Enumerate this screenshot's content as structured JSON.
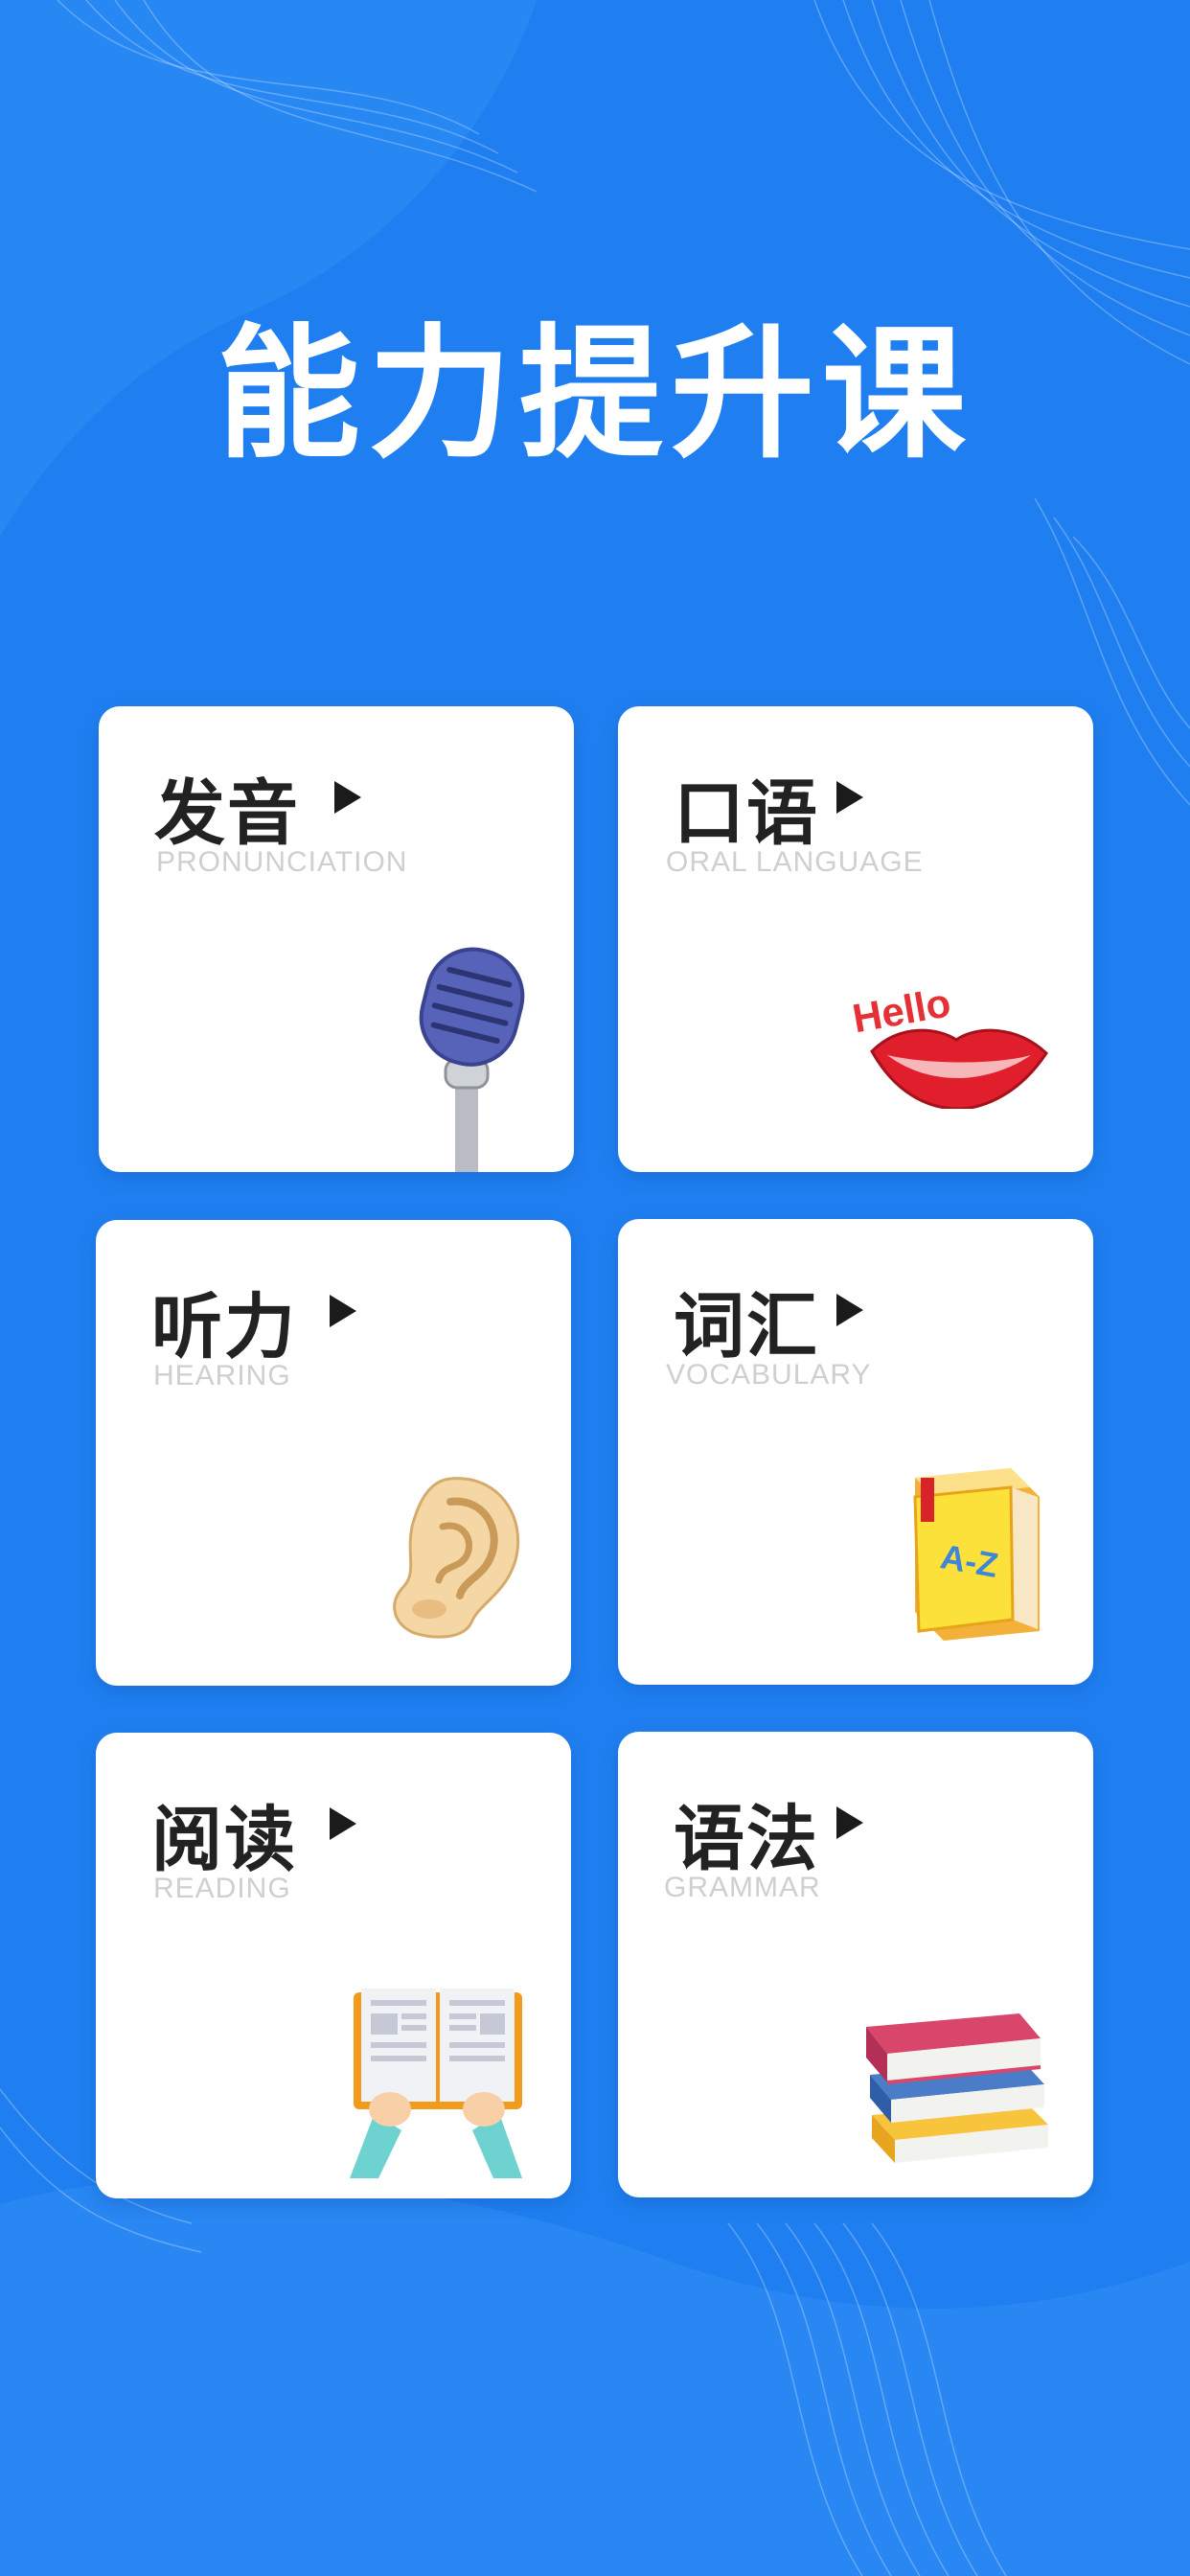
{
  "page": {
    "title": "能力提升课",
    "background_color": "#1f7ff0"
  },
  "cards": [
    {
      "title": "发音",
      "subtitle": "PRONUNCIATION",
      "illustration": "microphone-icon"
    },
    {
      "title": "口语",
      "subtitle": "ORAL LANGUAGE",
      "illustration": "hello-lips-icon",
      "illustration_text": "Hello"
    },
    {
      "title": "听力",
      "subtitle": "HEARING",
      "illustration": "ear-icon"
    },
    {
      "title": "词汇",
      "subtitle": "VOCABULARY",
      "illustration": "az-dictionary-icon",
      "illustration_text": "A-Z"
    },
    {
      "title": "阅读",
      "subtitle": "READING",
      "illustration": "open-book-hands-icon"
    },
    {
      "title": "语法",
      "subtitle": "GRAMMAR",
      "illustration": "book-stack-icon"
    }
  ]
}
